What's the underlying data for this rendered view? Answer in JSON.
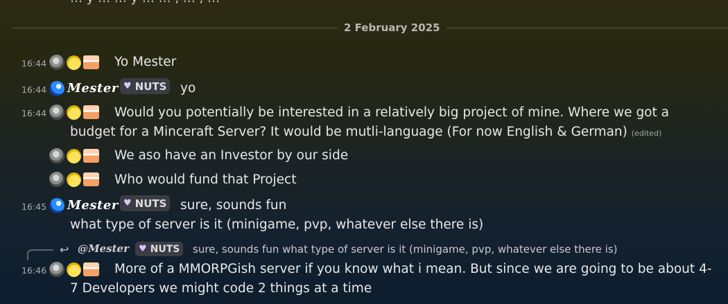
{
  "partial_top_text": "… y … … y … … , … , …",
  "date_divider": "2 February 2025",
  "users": {
    "mester_name": "Mester",
    "mester_tag": "NUTS"
  },
  "messages": [
    {
      "time": "16:44",
      "author": "fruit-user",
      "text": "Yo Mester"
    },
    {
      "time": "16:44",
      "author": "Mester",
      "text": "yo"
    },
    {
      "time": "16:44",
      "author": "fruit-user",
      "text": "Would you potentially be interested in a relatively big project of mine. Where we got a budget for a Minceraft Server? It would be mutli-language (For now English & German)",
      "edited": "(edited)"
    },
    {
      "time": "",
      "author": "fruit-user",
      "text": "We aso have an Investor by our side"
    },
    {
      "time": "",
      "author": "fruit-user",
      "text": "Who would fund that Project"
    },
    {
      "time": "16:45",
      "author": "Mester",
      "text": "sure, sounds fun",
      "continuation": "what type of server is it (minigame, pvp, whatever else there is)"
    },
    {
      "time": "16:46",
      "author": "fruit-user",
      "reply_to": "@Mester",
      "reply_tag": "NUTS",
      "reply_text": "sure, sounds fun what type of server is it (minigame, pvp, whatever else there is)",
      "text": "More of a MMORPGish server if you know what i mean. But since we are going to be about 4-7 Developers we might code 2 things at a time"
    }
  ],
  "colors": {
    "divider": "#5b5c52",
    "tag_bg": "#3b3d44",
    "text": "#e7e8ea"
  },
  "icons": [
    "gray-avatar-icon",
    "lemon-avatar-icon",
    "cake-avatar-icon",
    "blue-avatar-icon",
    "heart-icon",
    "reply-arrow-icon"
  ]
}
